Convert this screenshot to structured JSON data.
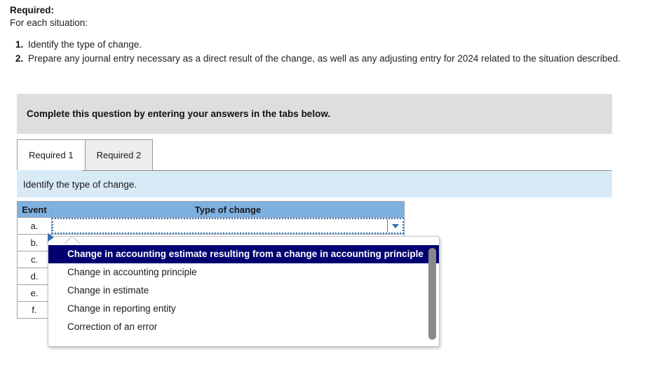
{
  "required": {
    "title": "Required:",
    "subtitle": "For each situation:",
    "items": [
      {
        "num": "1.",
        "text": "Identify the type of change."
      },
      {
        "num": "2.",
        "text": "Prepare any journal entry necessary as a direct result of the change, as well as any adjusting entry for 2024 related to the situation described."
      }
    ]
  },
  "banner": {
    "text": "Complete this question by entering your answers in the tabs below."
  },
  "tabs": [
    {
      "label": "Required 1",
      "active": true
    },
    {
      "label": "Required 2",
      "active": false
    }
  ],
  "instruction": {
    "text": "Identify the type of change."
  },
  "table": {
    "headers": {
      "event": "Event",
      "type": "Type of change"
    },
    "rows": [
      {
        "event": "a.",
        "value": ""
      },
      {
        "event": "b.",
        "value": ""
      },
      {
        "event": "c.",
        "value": ""
      },
      {
        "event": "d.",
        "value": ""
      },
      {
        "event": "e.",
        "value": ""
      },
      {
        "event": "f.",
        "value": ""
      }
    ]
  },
  "dropdown": {
    "open": true,
    "options": [
      "Change in accounting estimate resulting from a change in accounting principle",
      "Change in accounting principle",
      "Change in estimate",
      "Change in reporting entity",
      "Correction of an error"
    ],
    "highlighted_index": 0
  },
  "colors": {
    "banner_gray": "#dedede",
    "instruction_blue": "#d9eaf7",
    "table_header_blue": "#7eb0e0",
    "dropdown_highlight": "#000070",
    "focus_border": "#2f6fb5"
  }
}
